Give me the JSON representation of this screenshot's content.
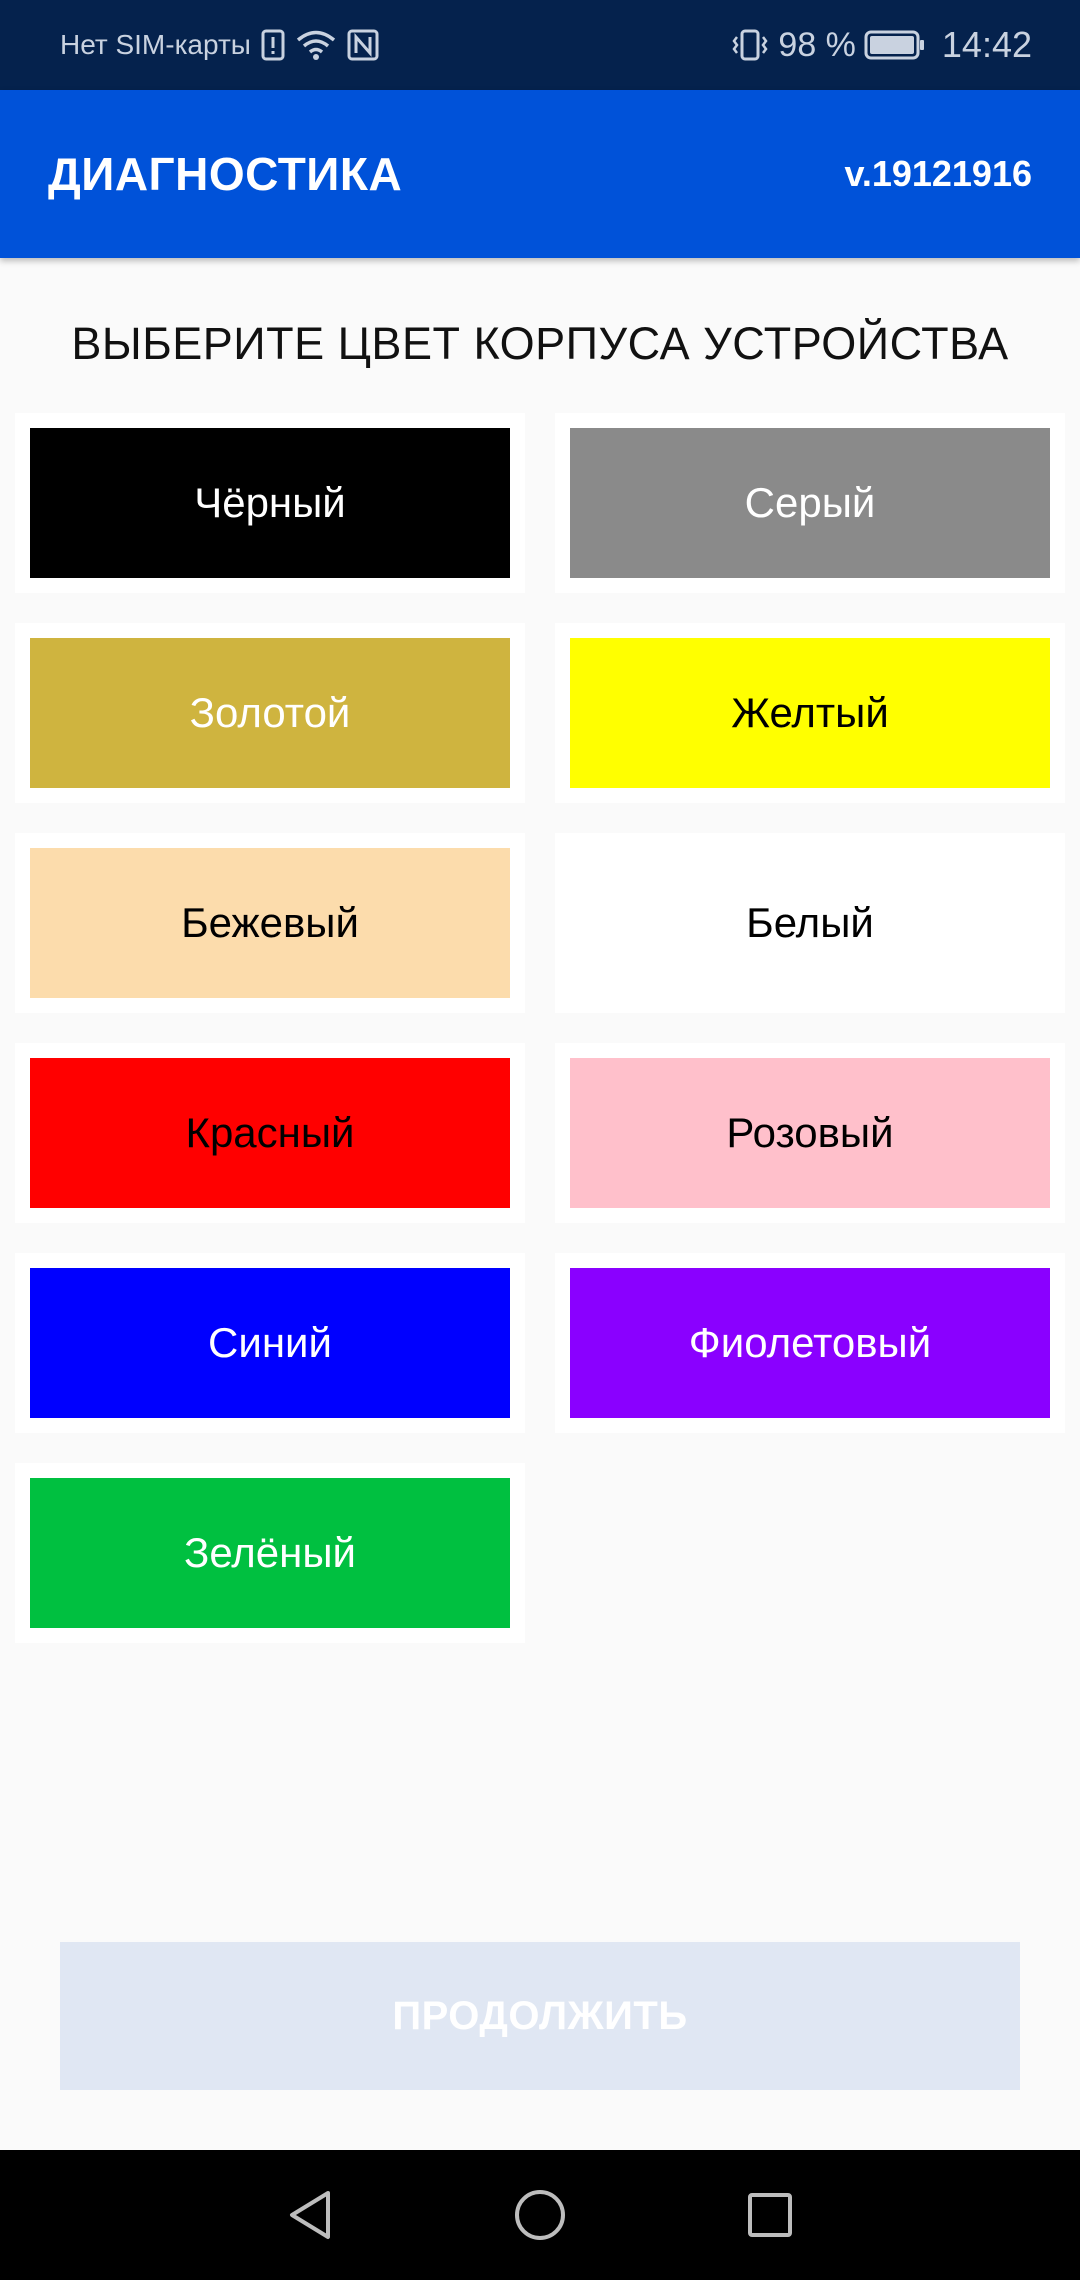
{
  "status_bar": {
    "carrier": "Нет SIM-карты",
    "battery": "98 %",
    "time": "14:42"
  },
  "app_bar": {
    "title": "ДИАГНОСТИКА",
    "version": "v.19121916"
  },
  "heading": "ВЫБЕРИТЕ ЦВЕТ КОРПУСА УСТРОЙСТВА",
  "colors": [
    {
      "label": "Чёрный",
      "bg": "#000000",
      "fg": "#ffffff"
    },
    {
      "label": "Серый",
      "bg": "#8a8a8a",
      "fg": "#ffffff"
    },
    {
      "label": "Золотой",
      "bg": "#cfb43f",
      "fg": "#ffffff"
    },
    {
      "label": "Желтый",
      "bg": "#ffff00",
      "fg": "#000000"
    },
    {
      "label": "Бежевый",
      "bg": "#fcdcac",
      "fg": "#000000"
    },
    {
      "label": "Белый",
      "bg": "#ffffff",
      "fg": "#000000"
    },
    {
      "label": "Красный",
      "bg": "#ff0000",
      "fg": "#000000"
    },
    {
      "label": "Розовый",
      "bg": "#ffc0cb",
      "fg": "#000000"
    },
    {
      "label": "Синий",
      "bg": "#0000ff",
      "fg": "#ffffff"
    },
    {
      "label": "Фиолетовый",
      "bg": "#8a00ff",
      "fg": "#ffffff"
    },
    {
      "label": "Зелёный",
      "bg": "#00c040",
      "fg": "#ffffff"
    }
  ],
  "continue_button": {
    "label": "ПРОДОЛЖИТЬ",
    "bg": "#e0e7f3"
  },
  "theme": {
    "status_bar_bg": "#05224d",
    "app_bar_bg": "#0052d9"
  }
}
